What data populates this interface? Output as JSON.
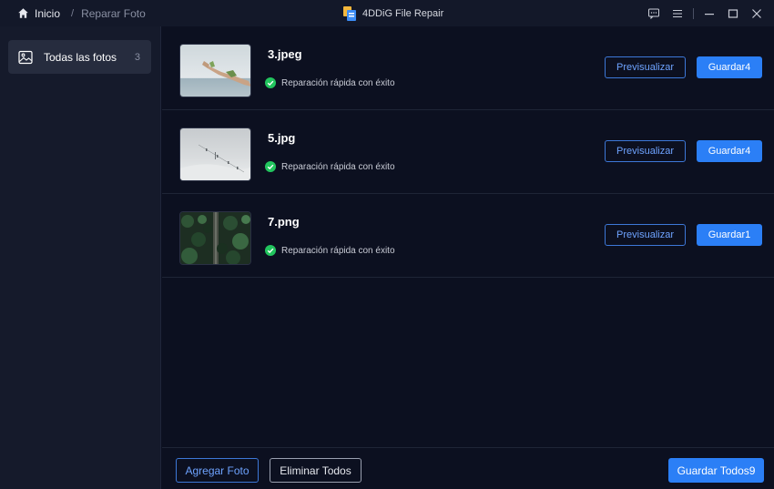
{
  "titlebar": {
    "home_label": "Inicio",
    "separator": "/",
    "current_page": "Reparar Foto",
    "app_title": "4DDiG File Repair"
  },
  "sidebar": {
    "items": [
      {
        "label": "Todas las fotos",
        "count": "3",
        "icon": "image-icon"
      }
    ]
  },
  "files": [
    {
      "name": "3.jpeg",
      "status": "Reparación rápida con éxito",
      "preview_label": "Previsualizar",
      "save_label": "Guardar4",
      "thumb": "hand-over-sea"
    },
    {
      "name": "5.jpg",
      "status": "Reparación rápida con éxito",
      "preview_label": "Previsualizar",
      "save_label": "Guardar4",
      "thumb": "foggy-ski-lift"
    },
    {
      "name": "7.png",
      "status": "Reparación rápida con éxito",
      "preview_label": "Previsualizar",
      "save_label": "Guardar1",
      "thumb": "forest-road-aerial"
    }
  ],
  "footer": {
    "add_label": "Agregar Foto",
    "delete_all_label": "Eliminar Todos",
    "save_all_label": "Guardar Todos9"
  },
  "colors": {
    "background": "#0c1020",
    "sidebar": "#151a2b",
    "accent": "#2b7ff6",
    "success": "#22c55e"
  }
}
